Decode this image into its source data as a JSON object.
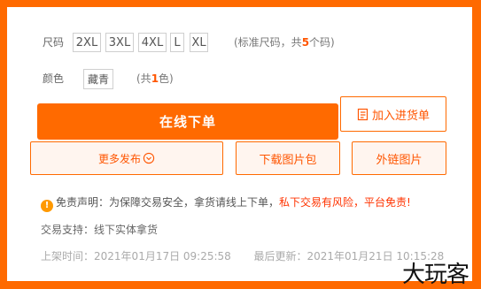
{
  "size": {
    "label": "尺码",
    "options": [
      "2XL",
      "3XL",
      "4XL",
      "L",
      "XL"
    ],
    "note_prefix": "(标准尺码，共",
    "count": "5",
    "note_suffix": "个码)"
  },
  "color": {
    "label": "颜色",
    "option": "藏青",
    "note_prefix": "(共",
    "count": "1",
    "note_suffix": "色)"
  },
  "actions": {
    "order_now": "在线下单",
    "add_to_stock_list": "加入进货单",
    "more_publish": "更多发布",
    "download_images": "下载图片包",
    "external_images": "外链图片"
  },
  "disclaimer": {
    "title": "免责声明：",
    "text": "为保障交易安全，拿货请线上下单，",
    "warning": "私下交易有风险，平台免责!"
  },
  "support": {
    "label": "交易支持：",
    "value": "线下实体拿货"
  },
  "timestamps": {
    "listed_label": "上架时间：",
    "listed_value": "2021年01月17日 09:25:58",
    "updated_label": "最后更新：",
    "updated_value": "2021年01月21日 10:15:28"
  },
  "watermark": "大玩客",
  "colors": {
    "brand_orange": "#ff6a00",
    "warn_red": "#ff3300"
  },
  "icons": [
    "list-icon",
    "chevron-down-circle-icon",
    "warning-icon"
  ]
}
